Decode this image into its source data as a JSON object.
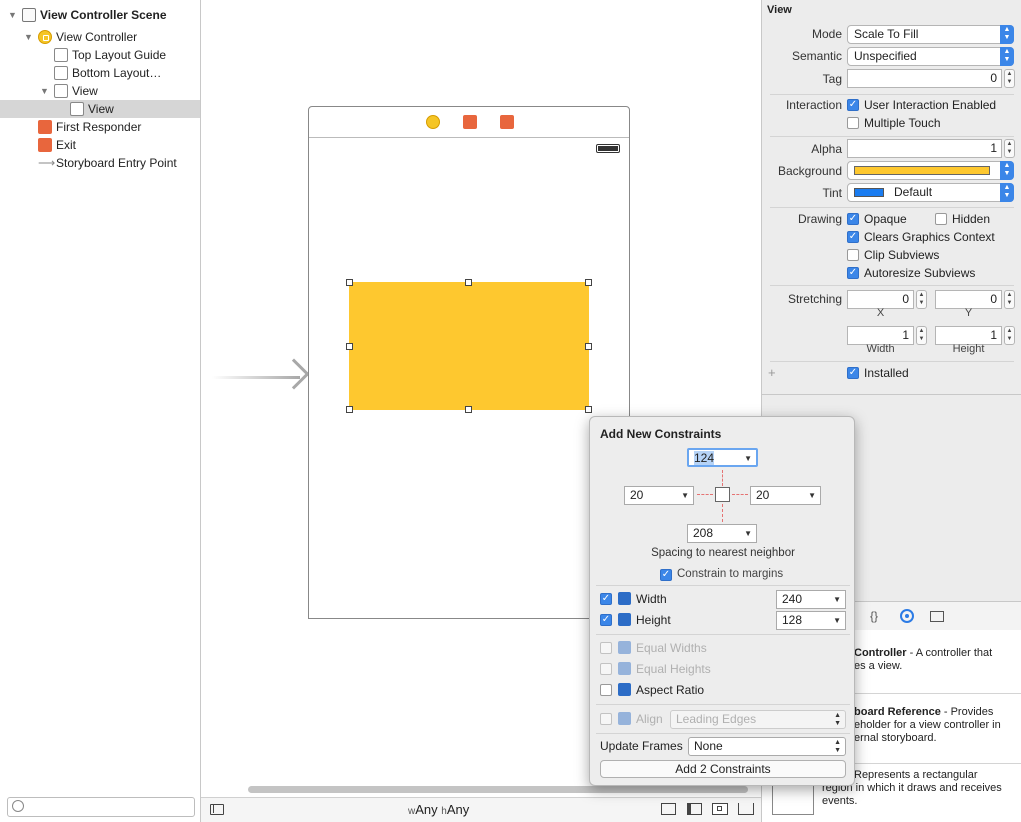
{
  "outline": {
    "items": [
      {
        "label": "View Controller Scene",
        "icon": "scene-icon"
      },
      {
        "label": "View Controller",
        "icon": "view-controller-icon"
      },
      {
        "label": "Top Layout Guide",
        "icon": "layout-guide-icon"
      },
      {
        "label": "Bottom Layout…",
        "icon": "layout-guide-icon"
      },
      {
        "label": "View",
        "icon": "view-icon"
      },
      {
        "label": "View",
        "icon": "view-icon"
      },
      {
        "label": "First Responder",
        "icon": "first-responder-icon"
      },
      {
        "label": "Exit",
        "icon": "exit-icon"
      },
      {
        "label": "Storyboard Entry Point",
        "icon": "entry-arrow-icon"
      }
    ]
  },
  "canvas": {
    "size_class_w_prefix": "w",
    "size_class_w": "Any",
    "size_class_h_prefix": "h",
    "size_class_h": "Any",
    "view_color": "#fec82f"
  },
  "inspector": {
    "section": "View",
    "mode_label": "Mode",
    "mode_value": "Scale To Fill",
    "semantic_label": "Semantic",
    "semantic_value": "Unspecified",
    "tag_label": "Tag",
    "tag_value": "0",
    "interaction_label": "Interaction",
    "user_interaction": "User Interaction Enabled",
    "multiple_touch": "Multiple Touch",
    "alpha_label": "Alpha",
    "alpha_value": "1",
    "background_label": "Background",
    "background_color": "#fec82f",
    "tint_label": "Tint",
    "tint_value": "Default",
    "tint_color": "#1a7cf0",
    "drawing_label": "Drawing",
    "opaque": "Opaque",
    "hidden": "Hidden",
    "clears": "Clears Graphics Context",
    "clip": "Clip Subviews",
    "autoresize": "Autoresize Subviews",
    "stretching_label": "Stretching",
    "stretch_x": "0",
    "stretch_y": "0",
    "x_label": "X",
    "y_label": "Y",
    "stretch_w": "1",
    "stretch_h": "1",
    "width_label": "Width",
    "height_label": "Height",
    "plus": "+",
    "installed": "Installed"
  },
  "library": {
    "item1_title": "Controller",
    "item1_desc_a": " - A controller that",
    "item1_desc_b": "es a view.",
    "item2_title": "board Reference",
    "item2_desc_a": " - Provides",
    "item2_desc_b": "eholder for a view controller in",
    "item2_desc_c": "ernal storyboard.",
    "item3_desc_a": " Represents a rectangular",
    "item3_desc_b": "region in which it draws and receives",
    "item3_desc_c": "events."
  },
  "popover": {
    "title": "Add New Constraints",
    "top": "124",
    "left": "20",
    "right": "20",
    "bottom": "208",
    "spacing_caption": "Spacing to nearest neighbor",
    "constrain_margins": "Constrain to margins",
    "width_label": "Width",
    "width_value": "240",
    "height_label": "Height",
    "height_value": "128",
    "equal_widths": "Equal Widths",
    "equal_heights": "Equal Heights",
    "aspect_ratio": "Aspect Ratio",
    "align_label": "Align",
    "align_value": "Leading Edges",
    "update_frames_label": "Update Frames",
    "update_frames_value": "None",
    "add_button": "Add 2 Constraints"
  }
}
